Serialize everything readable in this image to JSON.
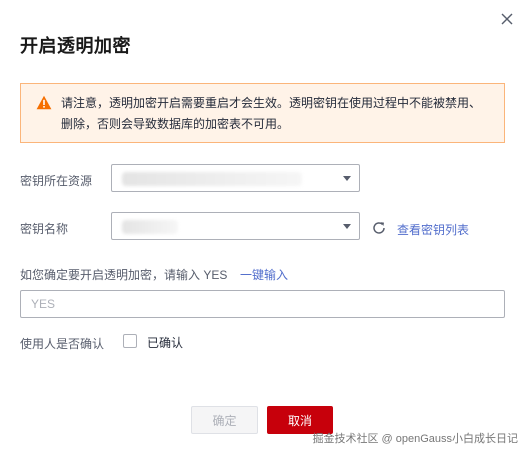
{
  "dialog": {
    "title": "开启透明加密",
    "close_icon": "close-icon"
  },
  "warning": {
    "icon": "warning-triangle-icon",
    "color": "#f66f00",
    "line1": "请注意，透明加密开启需要重启才会生效。透明密钥在使用过程中不能被禁用、",
    "line2": "删除，否则会导致数据库的加密表不可用。"
  },
  "form": {
    "key_source": {
      "label": "密钥所在资源"
    },
    "key_name": {
      "label": "密钥名称",
      "refresh_icon": "refresh-icon",
      "link": "查看密钥列表"
    },
    "confirm_input": {
      "prompt": "如您确定要开启透明加密，请输入 YES",
      "one_click_link": "一键输入",
      "placeholder": "YES"
    },
    "user_confirm": {
      "label": "使用人是否确认",
      "checkbox_label": "已确认",
      "checked": false
    }
  },
  "footer": {
    "ok_label": "确定",
    "cancel_label": "取消"
  },
  "watermark": "掘金技术社区 @ openGauss小白成长日记",
  "colors": {
    "primary_red": "#c7000b",
    "link_blue": "#526ecc",
    "warning_bg": "#fff3e8",
    "warning_border": "#fbb57a"
  }
}
